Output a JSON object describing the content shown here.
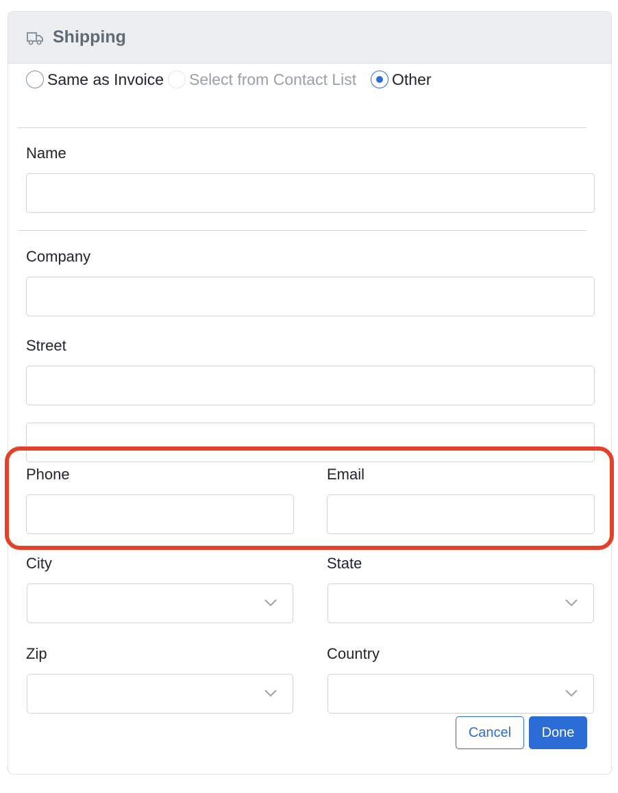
{
  "header": {
    "title": "Shipping",
    "icon": "truck-icon"
  },
  "address_options": [
    {
      "label": "Same as Invoice",
      "state": "unchecked"
    },
    {
      "label": "Select from Contact List",
      "state": "disabled"
    },
    {
      "label": "Other",
      "state": "checked"
    }
  ],
  "form": {
    "name_label": "Name",
    "name_value": "",
    "company_label": "Company",
    "company_value": "",
    "street_label": "Street",
    "street_value": "",
    "street2_value": "",
    "phone_label": "Phone",
    "phone_value": "",
    "email_label": "Email",
    "email_value": "",
    "city_label": "City",
    "city_value": "",
    "state_label": "State",
    "state_value": "",
    "zip_label": "Zip",
    "zip_value": "",
    "country_label": "Country",
    "country_value": ""
  },
  "buttons": {
    "cancel": "Cancel",
    "done": "Done"
  },
  "colors": {
    "accent": "#2b6cd6",
    "highlight": "#e6402b",
    "header_bg": "#eceef0",
    "header_text": "#5d6b79"
  }
}
